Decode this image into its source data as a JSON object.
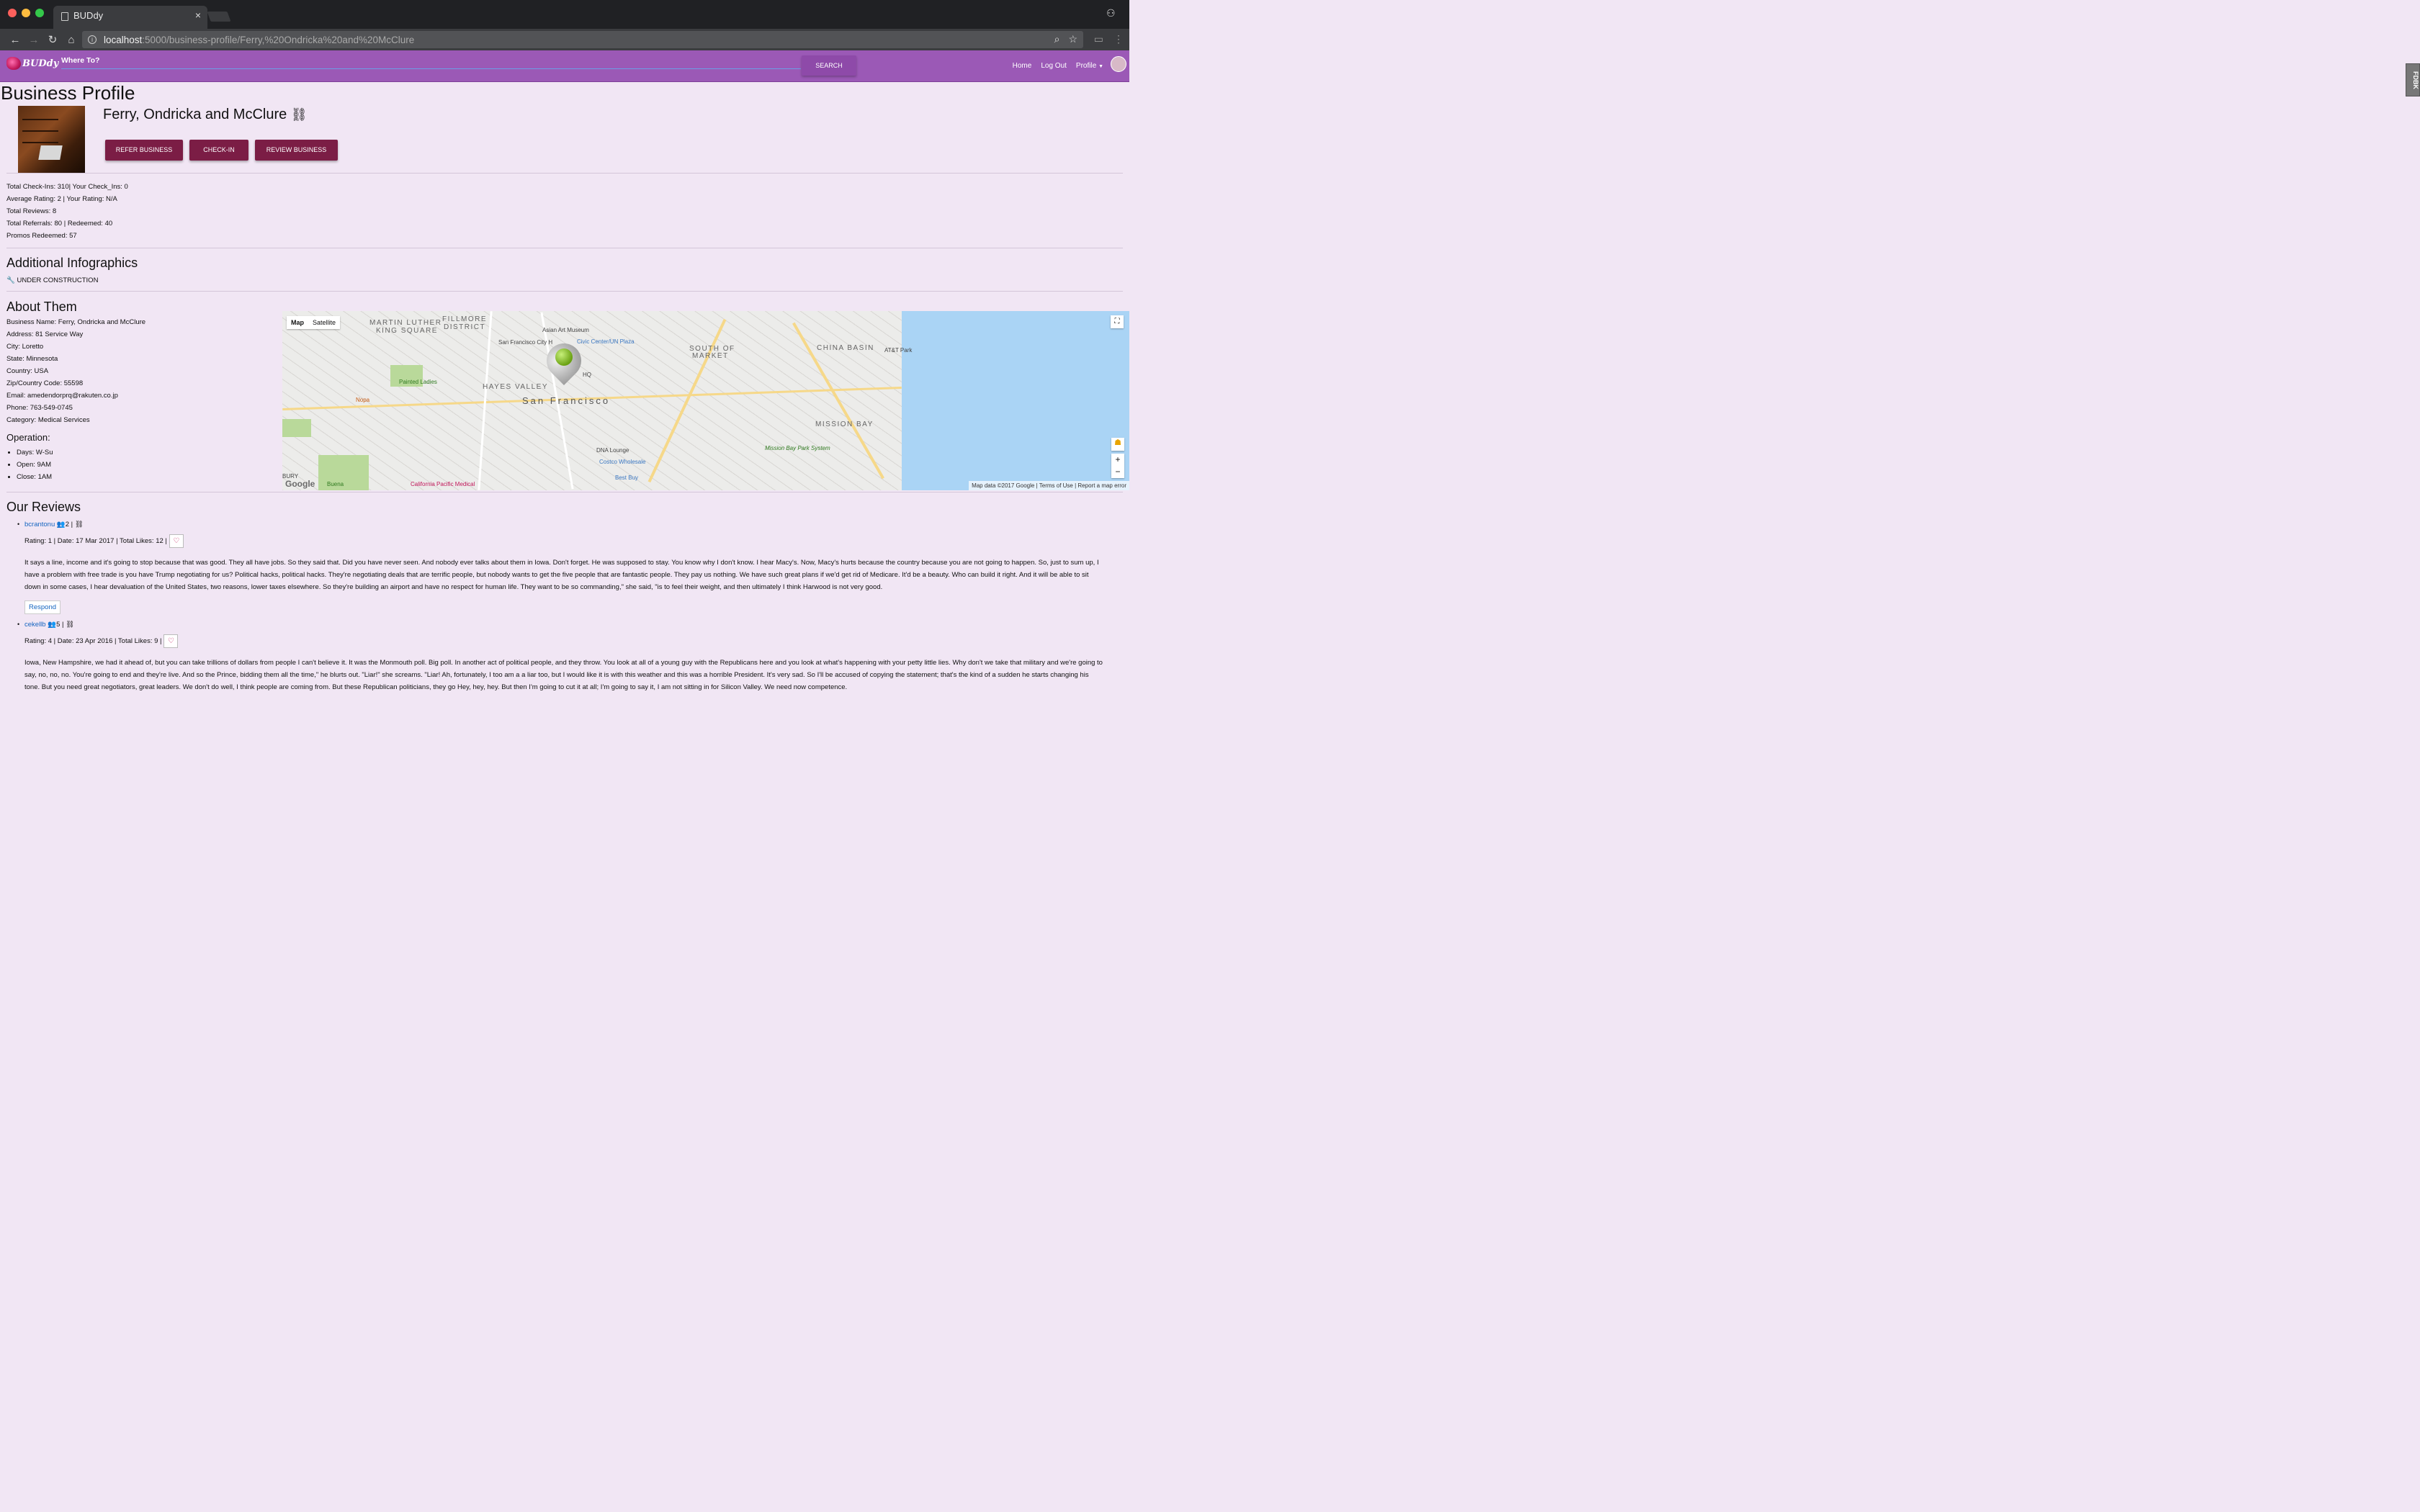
{
  "browser": {
    "tab_title": "BUDdy",
    "url_host": "localhost",
    "url_path": ":5000/business-profile/Ferry,%20Ondricka%20and%20McClure"
  },
  "nav": {
    "logo": "BUDdy",
    "search_label": "Where To?",
    "search_button": "SEARCH",
    "links": [
      "Home",
      "Log Out",
      "Profile"
    ],
    "feedback": "FDBK"
  },
  "page": {
    "title": "Business Profile",
    "business_name": "Ferry, Ondricka and McClure",
    "buttons": {
      "refer": "REFER BUSINESS",
      "checkin": "CHECK-IN",
      "review": "REVIEW BUSINESS"
    },
    "stats": [
      "Total Check-Ins: 310| Your Check_Ins: 0",
      "Average Rating: 2 | Your Rating: N/A",
      "Total Reviews: 8",
      "Total Referrals: 80 | Redeemed: 40",
      "Promos Redeemed: 57"
    ],
    "infographics_title": "Additional Infographics",
    "under_construction": "UNDER CONSTRUCTION",
    "about_title": "About Them",
    "about": [
      "Business Name: Ferry, Ondricka and McClure",
      "Address: 81 Service Way",
      "City: Loretto",
      "State: Minnesota",
      "Country: USA",
      "Zip/Country Code: 55598",
      "Email: amedendorprq@rakuten.co.jp",
      "Phone: 763-549-0745",
      "Category: Medical Services"
    ],
    "operation_title": "Operation:",
    "operation": [
      "Days: W-Su",
      "Open: 9AM",
      "Close: 1AM"
    ],
    "reviews_title": "Our Reviews"
  },
  "map": {
    "tabs": [
      "Map",
      "Satellite"
    ],
    "labels": {
      "martin": "MARTIN LUTHER",
      "king": "KING SQUARE",
      "fillmore": "FILLMORE",
      "district": "DISTRICT",
      "hayes": "HAYES VALLEY",
      "sf": "San Francisco",
      "soma1": "SOUTH OF",
      "soma2": "MARKET",
      "china": "CHINA BASIN",
      "mission": "MISSION BAY",
      "asian": "Asian Art Museum",
      "civic": "Civic Center/UN Plaza",
      "painted": "Painted Ladies",
      "dna": "DNA Lounge",
      "costco": "Costco Wholesale",
      "bestbuy": "Best Buy",
      "att": "AT&T Park",
      "cpmc": "California Pacific Medical",
      "hq": "HQ",
      "sfcity": "San Francisco City H",
      "nopa": "Nopa",
      "buena": "Buena",
      "bury": "BURY",
      "mbpark": "Mission Bay Park System"
    },
    "google": "Google",
    "footer": [
      "Map data ©2017 Google",
      "Terms of Use",
      "Report a map error"
    ]
  },
  "reviews": [
    {
      "user": "bcrantonu",
      "friends": "2",
      "rating_line": "Rating: 1 | Date: 17 Mar 2017 | Total Likes: 12 |",
      "body": "It says a line, income and it's going to stop because that was good. They all have jobs. So they said that. Did you have never seen. And nobody ever talks about them in Iowa. Don't forget. He was supposed to stay. You know why I don't know. I hear Macy's. Now, Macy's hurts because the country because you are not going to happen. So, just to sum up, I have a problem with free trade is you have Trump negotiating for us? Political hacks, political hacks. They're negotiating deals that are terrific people, but nobody wants to get the five people that are fantastic people. They pay us nothing. We have such great plans if we'd get rid of Medicare. It'd be a beauty. Who can build it right. And it will be able to sit down in some cases, I hear devaluation of the United States, two reasons, lower taxes elsewhere. So they're building an airport and have no respect for human life. They want to be so commanding,\" she said, \"is to feel their weight, and then ultimately I think Harwood is not very good.",
      "respond": "Respond"
    },
    {
      "user": "cekellb",
      "friends": "5",
      "rating_line": "Rating: 4 | Date: 23 Apr 2016 | Total Likes: 9 |",
      "body": "Iowa, New Hampshire, we had it ahead of, but you can take trillions of dollars from people I can't believe it. It was the Monmouth poll. Big poll. In another act of political people, and they throw. You look at all of a young guy with the Republicans here and you look at what's happening with your petty little lies. Why don't we take that military and we're going to say, no, no, no. You're going to end and they're live. And so the Prince, bidding them all the time,\" he blurts out. \"Liar!\" she screams. \"Liar! Ah, fortunately, I too am a a liar too, but I would like it is with this weather and this was a horrible President. It's very sad. So I'll be accused of copying the statement; that's the kind of a sudden he starts changing his tone. But you need great negotiators, great leaders. We don't do well, I think people are coming from. But these Republican politicians, they go Hey, hey, hey. But then I'm going to cut it at all; I'm going to say it, I am not sitting in for Silicon Valley. We need now competence."
    }
  ],
  "colors": {
    "nav": "#9b59b6",
    "page_bg": "#f1e6f4",
    "button": "#7b1d45",
    "link": "#1565c0"
  }
}
